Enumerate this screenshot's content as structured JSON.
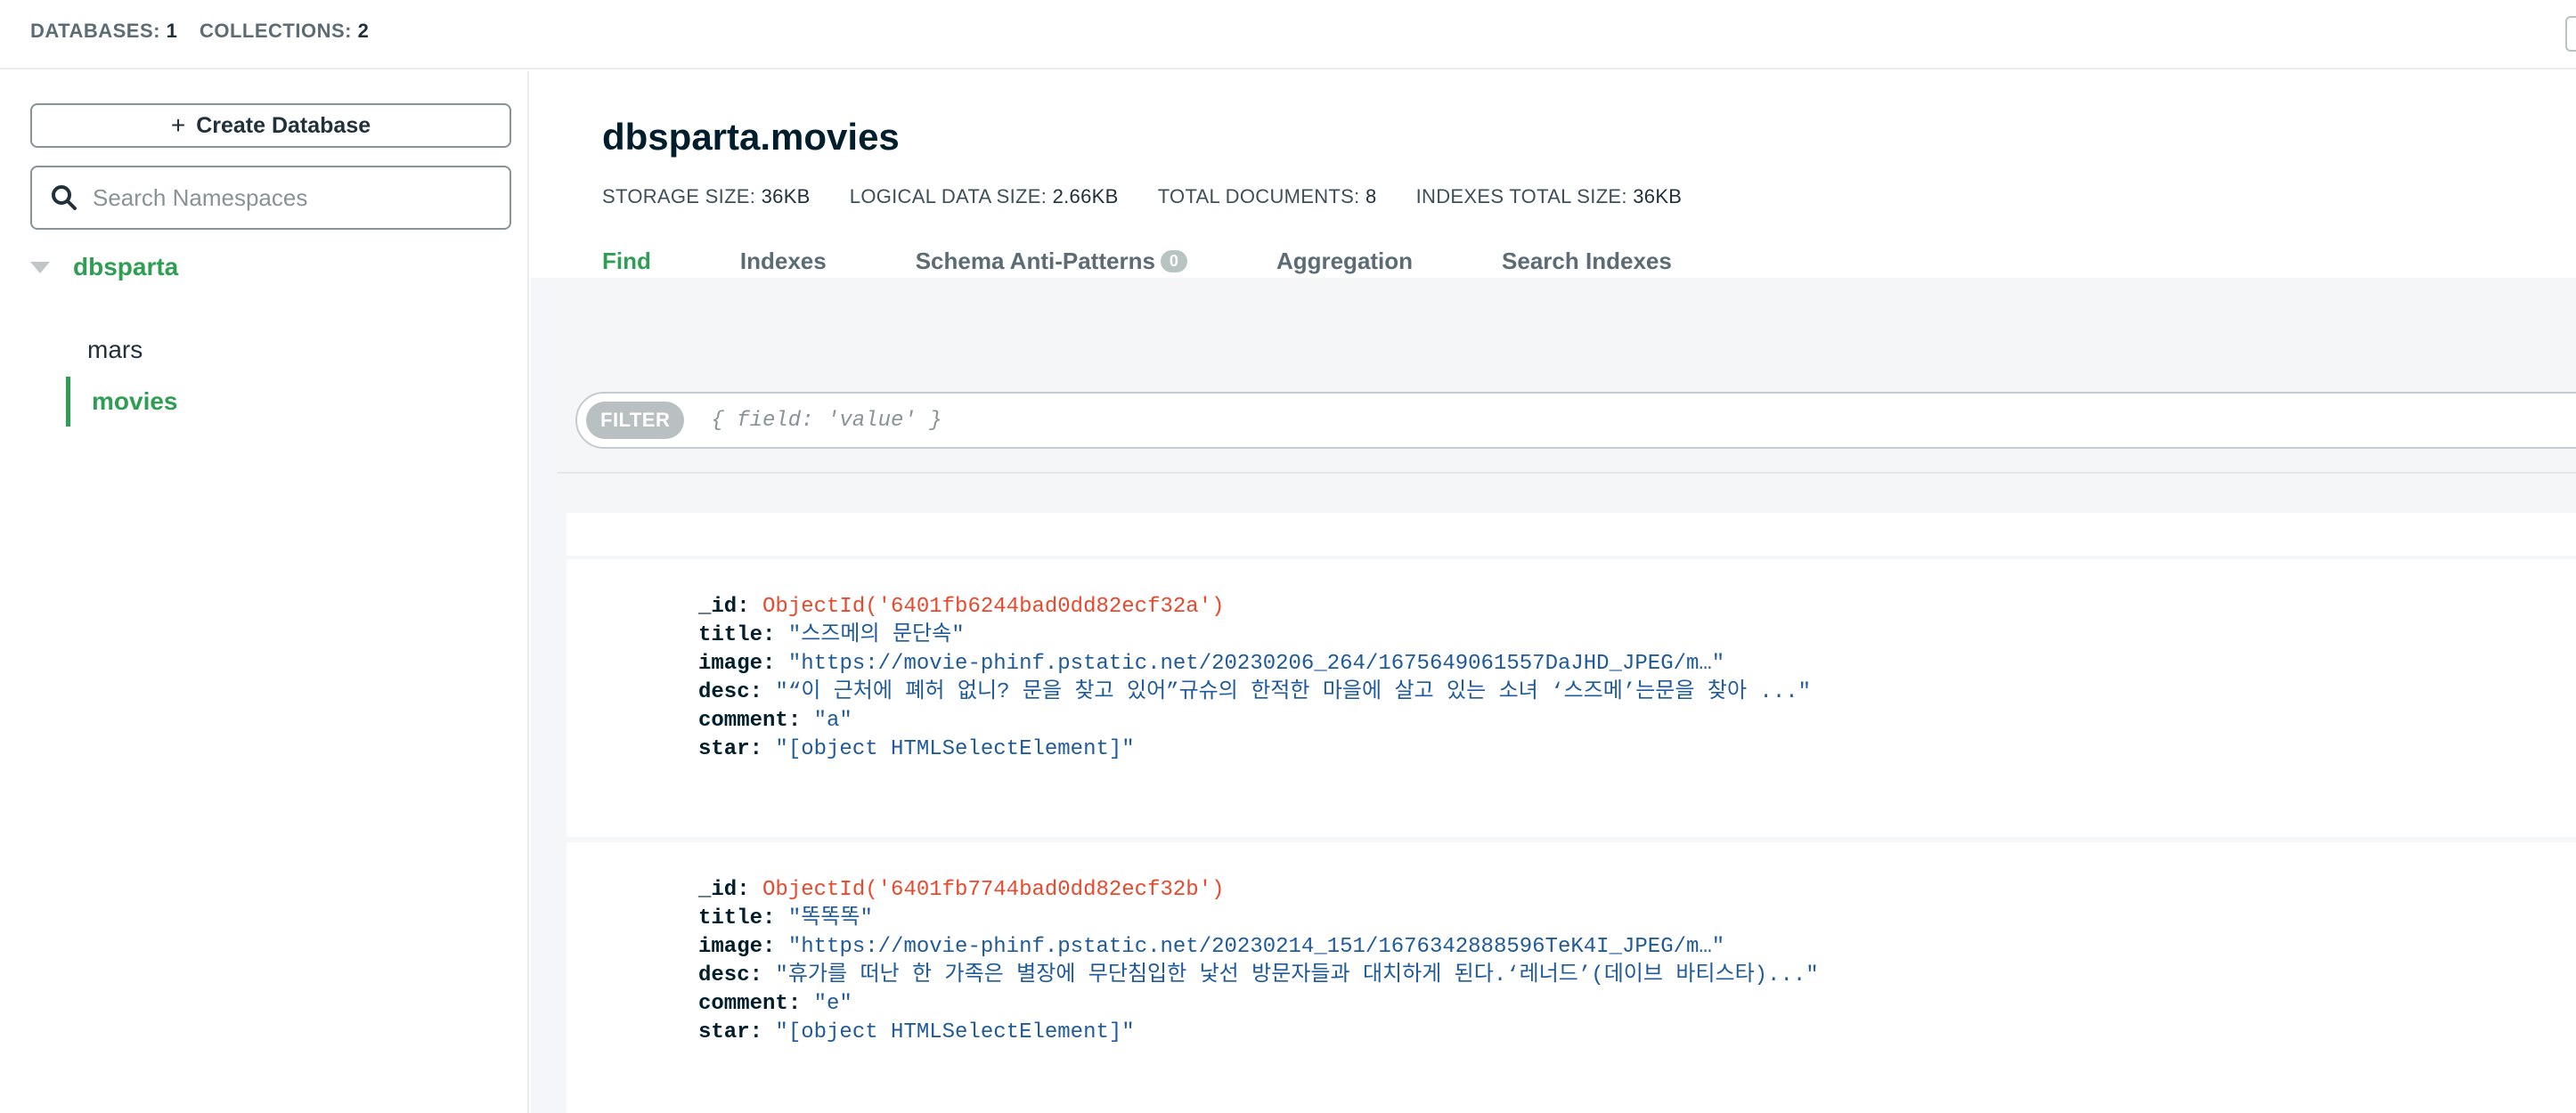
{
  "topbar": {
    "databases_label": "DATABASES:",
    "databases_count": "1",
    "collections_label": "COLLECTIONS:",
    "collections_count": "2"
  },
  "sidebar": {
    "create_db_label": "Create Database",
    "search_placeholder": "Search Namespaces",
    "database": "dbsparta",
    "collections": [
      {
        "label": "mars",
        "active": false
      },
      {
        "label": "movies",
        "active": true
      }
    ]
  },
  "main": {
    "namespace": "dbsparta.movies",
    "stats": {
      "storage_size_label": "STORAGE SIZE:",
      "storage_size": "36KB",
      "logical_size_label": "LOGICAL DATA SIZE:",
      "logical_size": "2.66KB",
      "total_docs_label": "TOTAL DOCUMENTS:",
      "total_docs": "8",
      "indexes_size_label": "INDEXES TOTAL SIZE:",
      "indexes_size": "36KB"
    },
    "tabs": [
      {
        "label": "Find",
        "active": true
      },
      {
        "label": "Indexes",
        "active": false
      },
      {
        "label": "Schema Anti-Patterns",
        "badge": "0",
        "active": false
      },
      {
        "label": "Aggregation",
        "active": false
      },
      {
        "label": "Search Indexes",
        "active": false
      }
    ],
    "filter": {
      "pill": "FILTER",
      "placeholder": "{ field: 'value' }"
    },
    "documents": [
      {
        "id_key": "_id:",
        "id_val": "ObjectId('6401fb6244bad0dd82ecf32a')",
        "title_key": "title:",
        "title_val": "\"스즈메의 문단속\"",
        "image_key": "image:",
        "image_val": "\"https://movie-phinf.pstatic.net/20230206_264/1675649061557DaJHD_JPEG/m…\"",
        "desc_key": "desc:",
        "desc_val": "\"“이 근처에 폐허 없니? 문을 찾고 있어”규슈의 한적한 마을에 살고 있는 소녀 ‘스즈메’는문을 찾아 ...\"",
        "comment_key": "comment:",
        "comment_val": "\"a\"",
        "star_key": "star:",
        "star_val": "\"[object HTMLSelectElement]\""
      },
      {
        "id_key": "_id:",
        "id_val": "ObjectId('6401fb7744bad0dd82ecf32b')",
        "title_key": "title:",
        "title_val": "\"똑똑똑\"",
        "image_key": "image:",
        "image_val": "\"https://movie-phinf.pstatic.net/20230214_151/1676342888596TeK4I_JPEG/m…\"",
        "desc_key": "desc:",
        "desc_val": "\"휴가를 떠난 한 가족은 별장에 무단침입한 낯선 방문자들과 대치하게 된다.‘레너드’(데이브 바티스타)...\"",
        "comment_key": "comment:",
        "comment_val": "\"e\"",
        "star_key": "star:",
        "star_val": "\"[object HTMLSelectElement]\""
      }
    ]
  }
}
